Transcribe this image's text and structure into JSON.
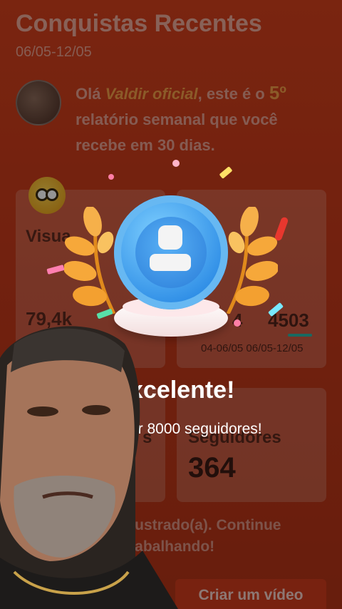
{
  "header": {
    "title": "Conquistas Recentes",
    "date_range": "06/05-12/05"
  },
  "greeting": {
    "prefix": "Olá ",
    "user_name": "Valdir oficial",
    "middle": ", este é o ",
    "number": "5º",
    "suffix": " relatório semanal que você recebe em 30 dias."
  },
  "cards": {
    "views_label": "Visua",
    "views_value": "79,4k",
    "right_value_a": "4",
    "right_value_b": "4503",
    "date_labels": "04-06/05 06/05-12/05",
    "followers_left_label": "s",
    "followers_label": "Seguidores",
    "followers_value": "364"
  },
  "overlay": {
    "title": "xcelente!",
    "subtitle": "or 8000 seguidores!"
  },
  "footer": {
    "message": "frustrado(a). Continue trabalhando!",
    "cta_label": "Criar um vídeo"
  },
  "colors": {
    "background": "#c4391a",
    "accent_gold": "#f3a83a",
    "medal_blue": "#2f8ee6",
    "teal": "#2bb5a8"
  },
  "icons": {
    "medal": "person-medal-icon",
    "laurel": "laurel-icon",
    "reaction": "surprised-emoji-icon"
  }
}
